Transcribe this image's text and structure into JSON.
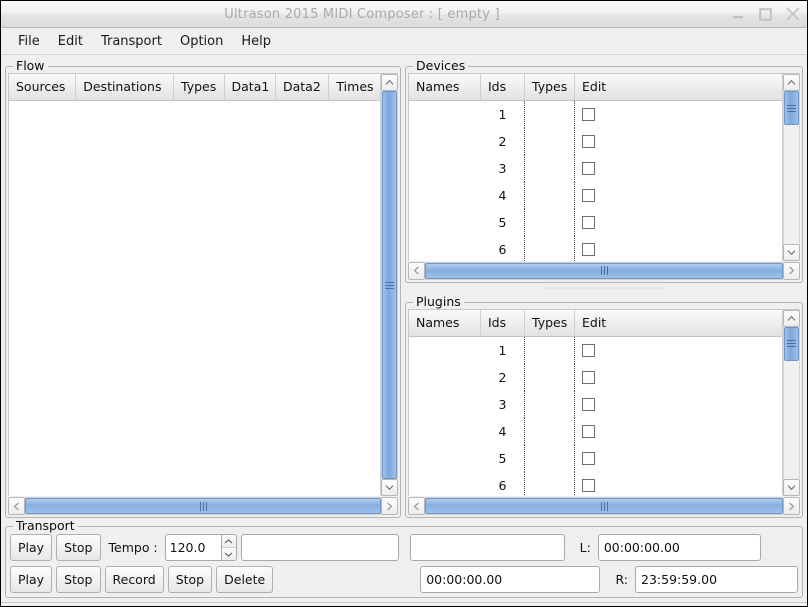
{
  "window": {
    "title": "Ultrason 2015 MIDI Composer : [ empty ]",
    "minimize_label": "minimize",
    "maximize_label": "maximize",
    "close_label": "close"
  },
  "menubar": {
    "items": [
      {
        "label": "File"
      },
      {
        "label": "Edit"
      },
      {
        "label": "Transport"
      },
      {
        "label": "Option"
      },
      {
        "label": "Help"
      }
    ]
  },
  "flow": {
    "title": "Flow",
    "columns": [
      "Sources",
      "Destinations",
      "Types",
      "Data1",
      "Data2",
      "Times"
    ],
    "rows": []
  },
  "devices": {
    "title": "Devices",
    "columns": [
      "Names",
      "Ids",
      "Types",
      "Edit"
    ],
    "rows": [
      {
        "name": "",
        "id": "1",
        "type": "",
        "edit": false
      },
      {
        "name": "",
        "id": "2",
        "type": "",
        "edit": false
      },
      {
        "name": "",
        "id": "3",
        "type": "",
        "edit": false
      },
      {
        "name": "",
        "id": "4",
        "type": "",
        "edit": false
      },
      {
        "name": "",
        "id": "5",
        "type": "",
        "edit": false
      },
      {
        "name": "",
        "id": "6",
        "type": "",
        "edit": false
      }
    ]
  },
  "plugins": {
    "title": "Plugins",
    "columns": [
      "Names",
      "Ids",
      "Types",
      "Edit"
    ],
    "rows": [
      {
        "name": "",
        "id": "1",
        "type": "",
        "edit": false
      },
      {
        "name": "",
        "id": "2",
        "type": "",
        "edit": false
      },
      {
        "name": "",
        "id": "3",
        "type": "",
        "edit": false
      },
      {
        "name": "",
        "id": "4",
        "type": "",
        "edit": false
      },
      {
        "name": "",
        "id": "5",
        "type": "",
        "edit": false
      },
      {
        "name": "",
        "id": "6",
        "type": "",
        "edit": false
      }
    ]
  },
  "transport": {
    "title": "Transport",
    "row1": {
      "play_label": "Play",
      "stop_label": "Stop",
      "tempo_label": "Tempo :",
      "tempo_value": "120.0",
      "field_a_value": "",
      "field_a_placeholder": "",
      "field_b_value": "",
      "field_b_placeholder": "",
      "left_marker_label": "L:",
      "left_marker_value": "00:00:00.00"
    },
    "row2": {
      "play_label": "Play",
      "stop_label": "Stop",
      "record_label": "Record",
      "stop2_label": "Stop",
      "delete_label": "Delete",
      "position_value": "00:00:00.00",
      "right_marker_label": "R:",
      "right_marker_value": "23:59:59.00"
    }
  },
  "theme": {
    "window_bg": "#efefef",
    "scroll_thumb": "#85aee2",
    "title_text": "#a9a9a9",
    "border": "#b4b4b4"
  }
}
